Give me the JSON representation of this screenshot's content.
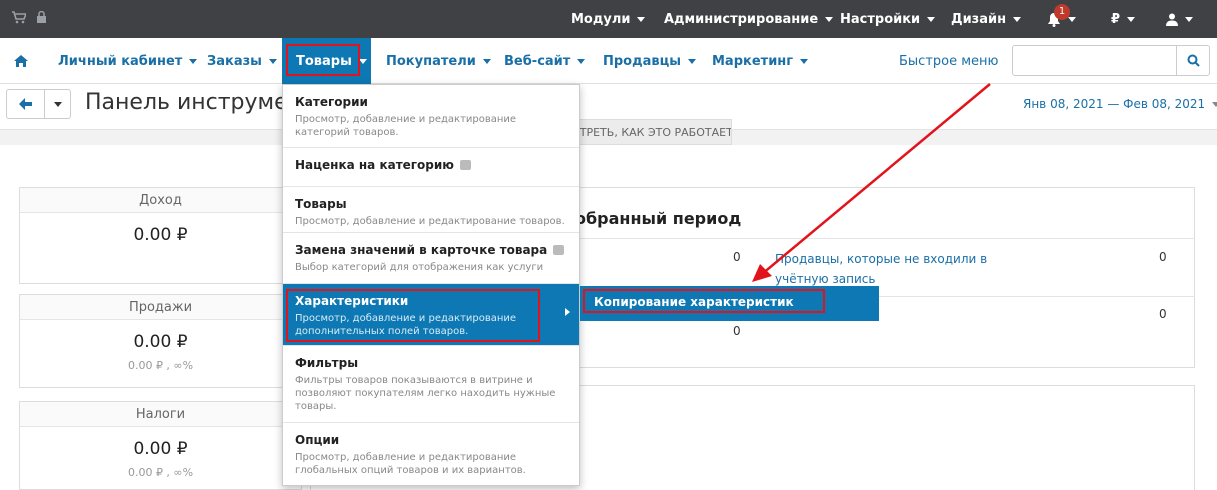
{
  "topbar": {
    "menus": [
      {
        "label": "Модули"
      },
      {
        "label": "Администрирование"
      },
      {
        "label": "Настройки"
      },
      {
        "label": "Дизайн"
      }
    ],
    "notifications_count": "1",
    "currency": "₽"
  },
  "navbar": {
    "items": [
      {
        "label": "Личный кабинет"
      },
      {
        "label": "Заказы"
      },
      {
        "label": "Товары"
      },
      {
        "label": "Покупатели"
      },
      {
        "label": "Веб-сайт"
      },
      {
        "label": "Продавцы"
      },
      {
        "label": "Маркетинг"
      }
    ],
    "quick_menu": "Быстрое меню",
    "search_placeholder": ""
  },
  "page": {
    "title": "Панель инструментов",
    "date_range": "Янв 08, 2021 — Фев 08, 2021",
    "how_it_works": "ПОСМОТРЕТЬ, КАК ЭТО РАБОТАЕТ"
  },
  "stats": [
    {
      "label": "Доход",
      "value": "0.00 ₽",
      "sub": ""
    },
    {
      "label": "Продажи",
      "value": "0.00 ₽",
      "sub": "0.00 ₽ , ∞%"
    },
    {
      "label": "Налоги",
      "value": "0.00 ₽",
      "sub": "0.00 ₽ , ∞%"
    }
  ],
  "panel": {
    "title": "обранный период",
    "values": [
      "0",
      "0",
      "0",
      "0"
    ],
    "link": "Продавцы, которые не входили в учётную запись"
  },
  "dropdown": {
    "items": [
      {
        "title": "Категории",
        "desc": "Просмотр, добавление и редактирование категорий товаров."
      },
      {
        "title": "Наценка на категорию",
        "desc": ""
      },
      {
        "title": "Товары",
        "desc": "Просмотр, добавление и редактирование товаров."
      },
      {
        "title": "Замена значений в карточке товара",
        "desc": "Выбор категорий для отображения как услуги"
      },
      {
        "title": "Характеристики",
        "desc": "Просмотр, добавление и редактирование дополнительных полей товаров."
      },
      {
        "title": "Фильтры",
        "desc": "Фильтры товаров показываются в витрине и позволяют покупателям легко находить нужные товары."
      },
      {
        "title": "Опции",
        "desc": "Просмотр, добавление и редактирование глобальных опций товаров и их вариантов."
      }
    ]
  },
  "submenu": {
    "item": "Копирование характеристик"
  },
  "colors": {
    "topbar": "#3f4144",
    "accent": "#0d78b3",
    "highlight": "#e1141b"
  }
}
